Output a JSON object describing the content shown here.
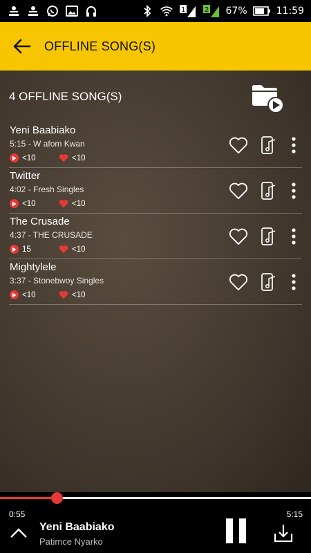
{
  "status_bar": {
    "battery": "67%",
    "time": "11:59",
    "sim1": "1",
    "sim2": "2",
    "left_icons": [
      "usb-debug-icon",
      "usb-debug-icon",
      "whatsapp-icon",
      "gallery-icon",
      "headphones-icon"
    ],
    "right_icons": [
      "bluetooth-icon",
      "wifi-icon",
      "signal-icon",
      "signal-icon",
      "battery-icon"
    ]
  },
  "appbar": {
    "title": "OFFLINE SONG(S)",
    "back_icon": "arrow-back-icon"
  },
  "header": {
    "count_label": "4 OFFLINE SONG(S)",
    "folder_icon": "folder-play-icon"
  },
  "songs": [
    {
      "title": "Yeni Baabiako",
      "meta": "5:15 -  W afom Kwan",
      "plays": "<10",
      "likes": "<10"
    },
    {
      "title": "Twitter",
      "meta": "4:02 -  Fresh Singles",
      "plays": "<10",
      "likes": "<10"
    },
    {
      "title": "The Crusade",
      "meta": "4:37 -  THE CRUSADE",
      "plays": "15",
      "likes": "<10"
    },
    {
      "title": "Mightylele",
      "meta": "3:37 -  Stonebwoy Singles",
      "plays": "<10",
      "likes": "<10"
    }
  ],
  "player": {
    "current_time": "0:55",
    "total_time": "5:15",
    "progress_fraction": 0.182,
    "title": "Yeni Baabiako",
    "artist": "Patimce Nyarko"
  },
  "colors": {
    "accent": "#f8c600",
    "red": "#e53935"
  }
}
